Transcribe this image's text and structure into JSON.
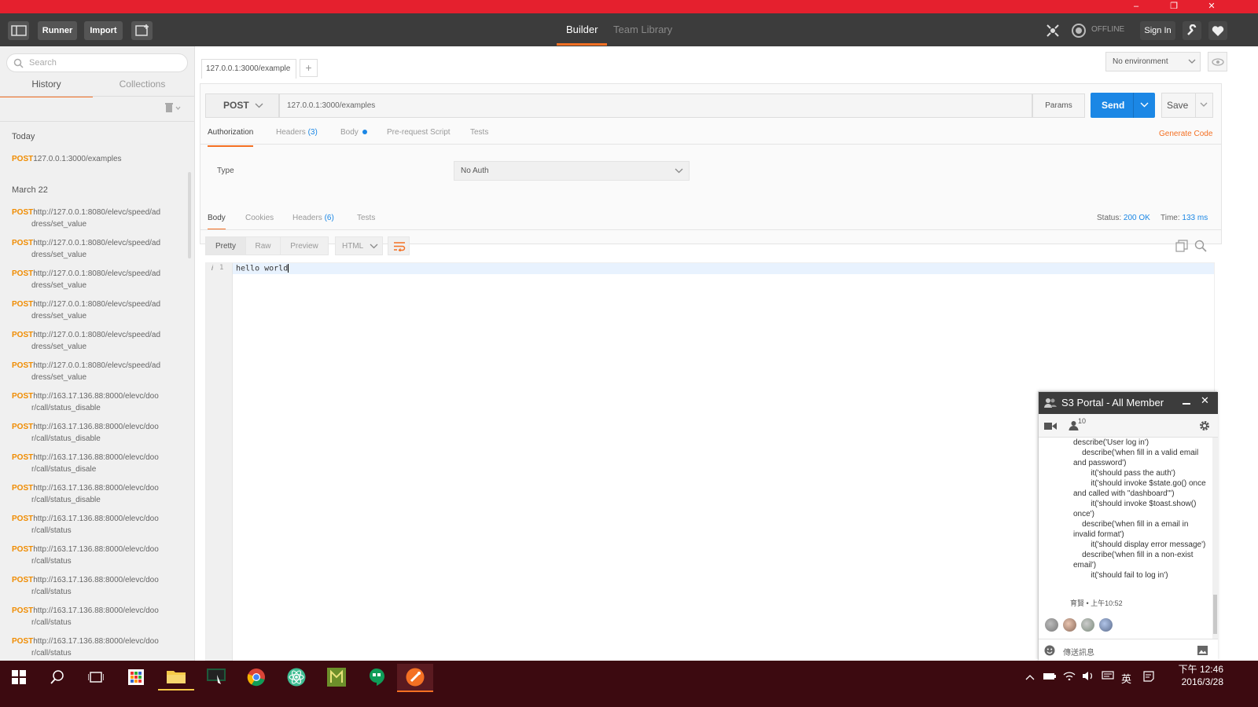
{
  "window": {
    "minimize": "–",
    "restore": "❐",
    "close": "✕"
  },
  "topbar": {
    "runner": "Runner",
    "import": "Import",
    "tabs": [
      "Builder",
      "Team Library"
    ],
    "offline": "OFFLINE",
    "signin": "Sign In"
  },
  "sidebar": {
    "search_placeholder": "Search",
    "tabs": [
      "History",
      "Collections"
    ],
    "groups": [
      {
        "day": "Today",
        "items": [
          {
            "method": "POST",
            "line1": "127.0.0.1:3000/examples",
            "line2": ""
          }
        ]
      },
      {
        "day": "March 22",
        "items": [
          {
            "method": "POST",
            "line1": "http://127.0.0.1:8080/elevc/speed/ad",
            "line2": "dress/set_value"
          },
          {
            "method": "POST",
            "line1": "http://127.0.0.1:8080/elevc/speed/ad",
            "line2": "dress/set_value"
          },
          {
            "method": "POST",
            "line1": "http://127.0.0.1:8080/elevc/speed/ad",
            "line2": "dress/set_value"
          },
          {
            "method": "POST",
            "line1": "http://127.0.0.1:8080/elevc/speed/ad",
            "line2": "dress/set_value"
          },
          {
            "method": "POST",
            "line1": "http://127.0.0.1:8080/elevc/speed/ad",
            "line2": "dress/set_value"
          },
          {
            "method": "POST",
            "line1": "http://127.0.0.1:8080/elevc/speed/ad",
            "line2": "dress/set_value"
          },
          {
            "method": "POST",
            "line1": "http://163.17.136.88:8000/elevc/doo",
            "line2": "r/call/status_disable"
          },
          {
            "method": "POST",
            "line1": "http://163.17.136.88:8000/elevc/doo",
            "line2": "r/call/status_disable"
          },
          {
            "method": "POST",
            "line1": "http://163.17.136.88:8000/elevc/doo",
            "line2": "r/call/status_disale"
          },
          {
            "method": "POST",
            "line1": "http://163.17.136.88:8000/elevc/doo",
            "line2": "r/call/status_disable"
          },
          {
            "method": "POST",
            "line1": "http://163.17.136.88:8000/elevc/doo",
            "line2": "r/call/status"
          },
          {
            "method": "POST",
            "line1": "http://163.17.136.88:8000/elevc/doo",
            "line2": "r/call/status"
          },
          {
            "method": "POST",
            "line1": "http://163.17.136.88:8000/elevc/doo",
            "line2": "r/call/status"
          },
          {
            "method": "POST",
            "line1": "http://163.17.136.88:8000/elevc/doo",
            "line2": "r/call/status"
          },
          {
            "method": "POST",
            "line1": "http://163.17.136.88:8000/elevc/doo",
            "line2": "r/call/status"
          }
        ]
      }
    ]
  },
  "request": {
    "tab_label": "127.0.0.1:3000/example",
    "add_tab": "+",
    "environment": "No environment",
    "method": "POST",
    "url": "127.0.0.1:3000/examples",
    "params": "Params",
    "send": "Send",
    "save": "Save",
    "tabs": [
      "Authorization",
      "Headers",
      "Body",
      "Pre-request Script",
      "Tests"
    ],
    "headers_count": "(3)",
    "generate_code": "Generate Code",
    "auth_type_label": "Type",
    "auth_type_value": "No Auth"
  },
  "response": {
    "tabs": [
      "Body",
      "Cookies",
      "Headers",
      "Tests"
    ],
    "headers_count": "(6)",
    "status_label": "Status:",
    "status_value": "200 OK",
    "time_label": "Time:",
    "time_value": "133 ms",
    "view_modes": [
      "Pretty",
      "Raw",
      "Preview"
    ],
    "format": "HTML",
    "line_number": "1",
    "line_marker": "i",
    "body": "hello world"
  },
  "chat": {
    "title": "S3 Portal - All Member",
    "members": "10",
    "message": "describe('User log in')\n    describe('when fill in a valid email and password')\n        it('should pass the auth')\n        it('should invoke $state.go() once and called with \"dashboard\"')\n        it('should invoke $toast.show() once')\n    describe('when fill in a email in invalid format')\n        it('should display error message')\n    describe('when fill in a non-exist email')\n        it('should fail to log in')",
    "meta": "育賢 • 上午10:52",
    "input_placeholder": "傳送訊息"
  },
  "taskbar": {
    "ime": "英",
    "time": "下午 12:46",
    "date": "2016/3/28"
  },
  "colors": {
    "accent": "#f47023",
    "send": "#1b87e5",
    "titlebar": "#e5202e",
    "method": "#f08c00"
  }
}
